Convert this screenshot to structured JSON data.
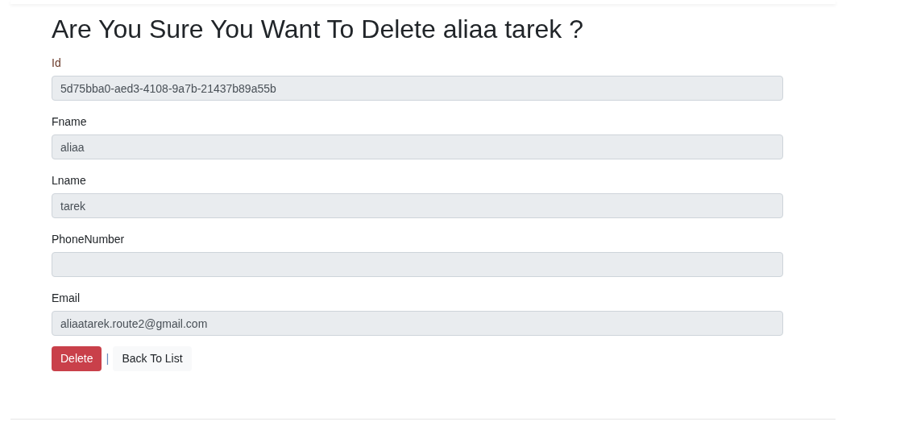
{
  "heading": "Are You Sure You Want To Delete aliaa tarek ?",
  "fields": [
    {
      "label": "Id",
      "value": "5d75bba0-aed3-4108-9a7b-21437b89a55b",
      "disabled": true
    },
    {
      "label": "Fname",
      "value": "aliaa",
      "disabled": true
    },
    {
      "label": "Lname",
      "value": "tarek",
      "disabled": true
    },
    {
      "label": "PhoneNumber",
      "disabled": true
    },
    {
      "label": "Email",
      "value": "aliaatarek.route2@gmail.com",
      "disabled": true
    }
  ],
  "actions": {
    "delete": "Delete",
    "separator": "|",
    "back": "Back To List"
  }
}
